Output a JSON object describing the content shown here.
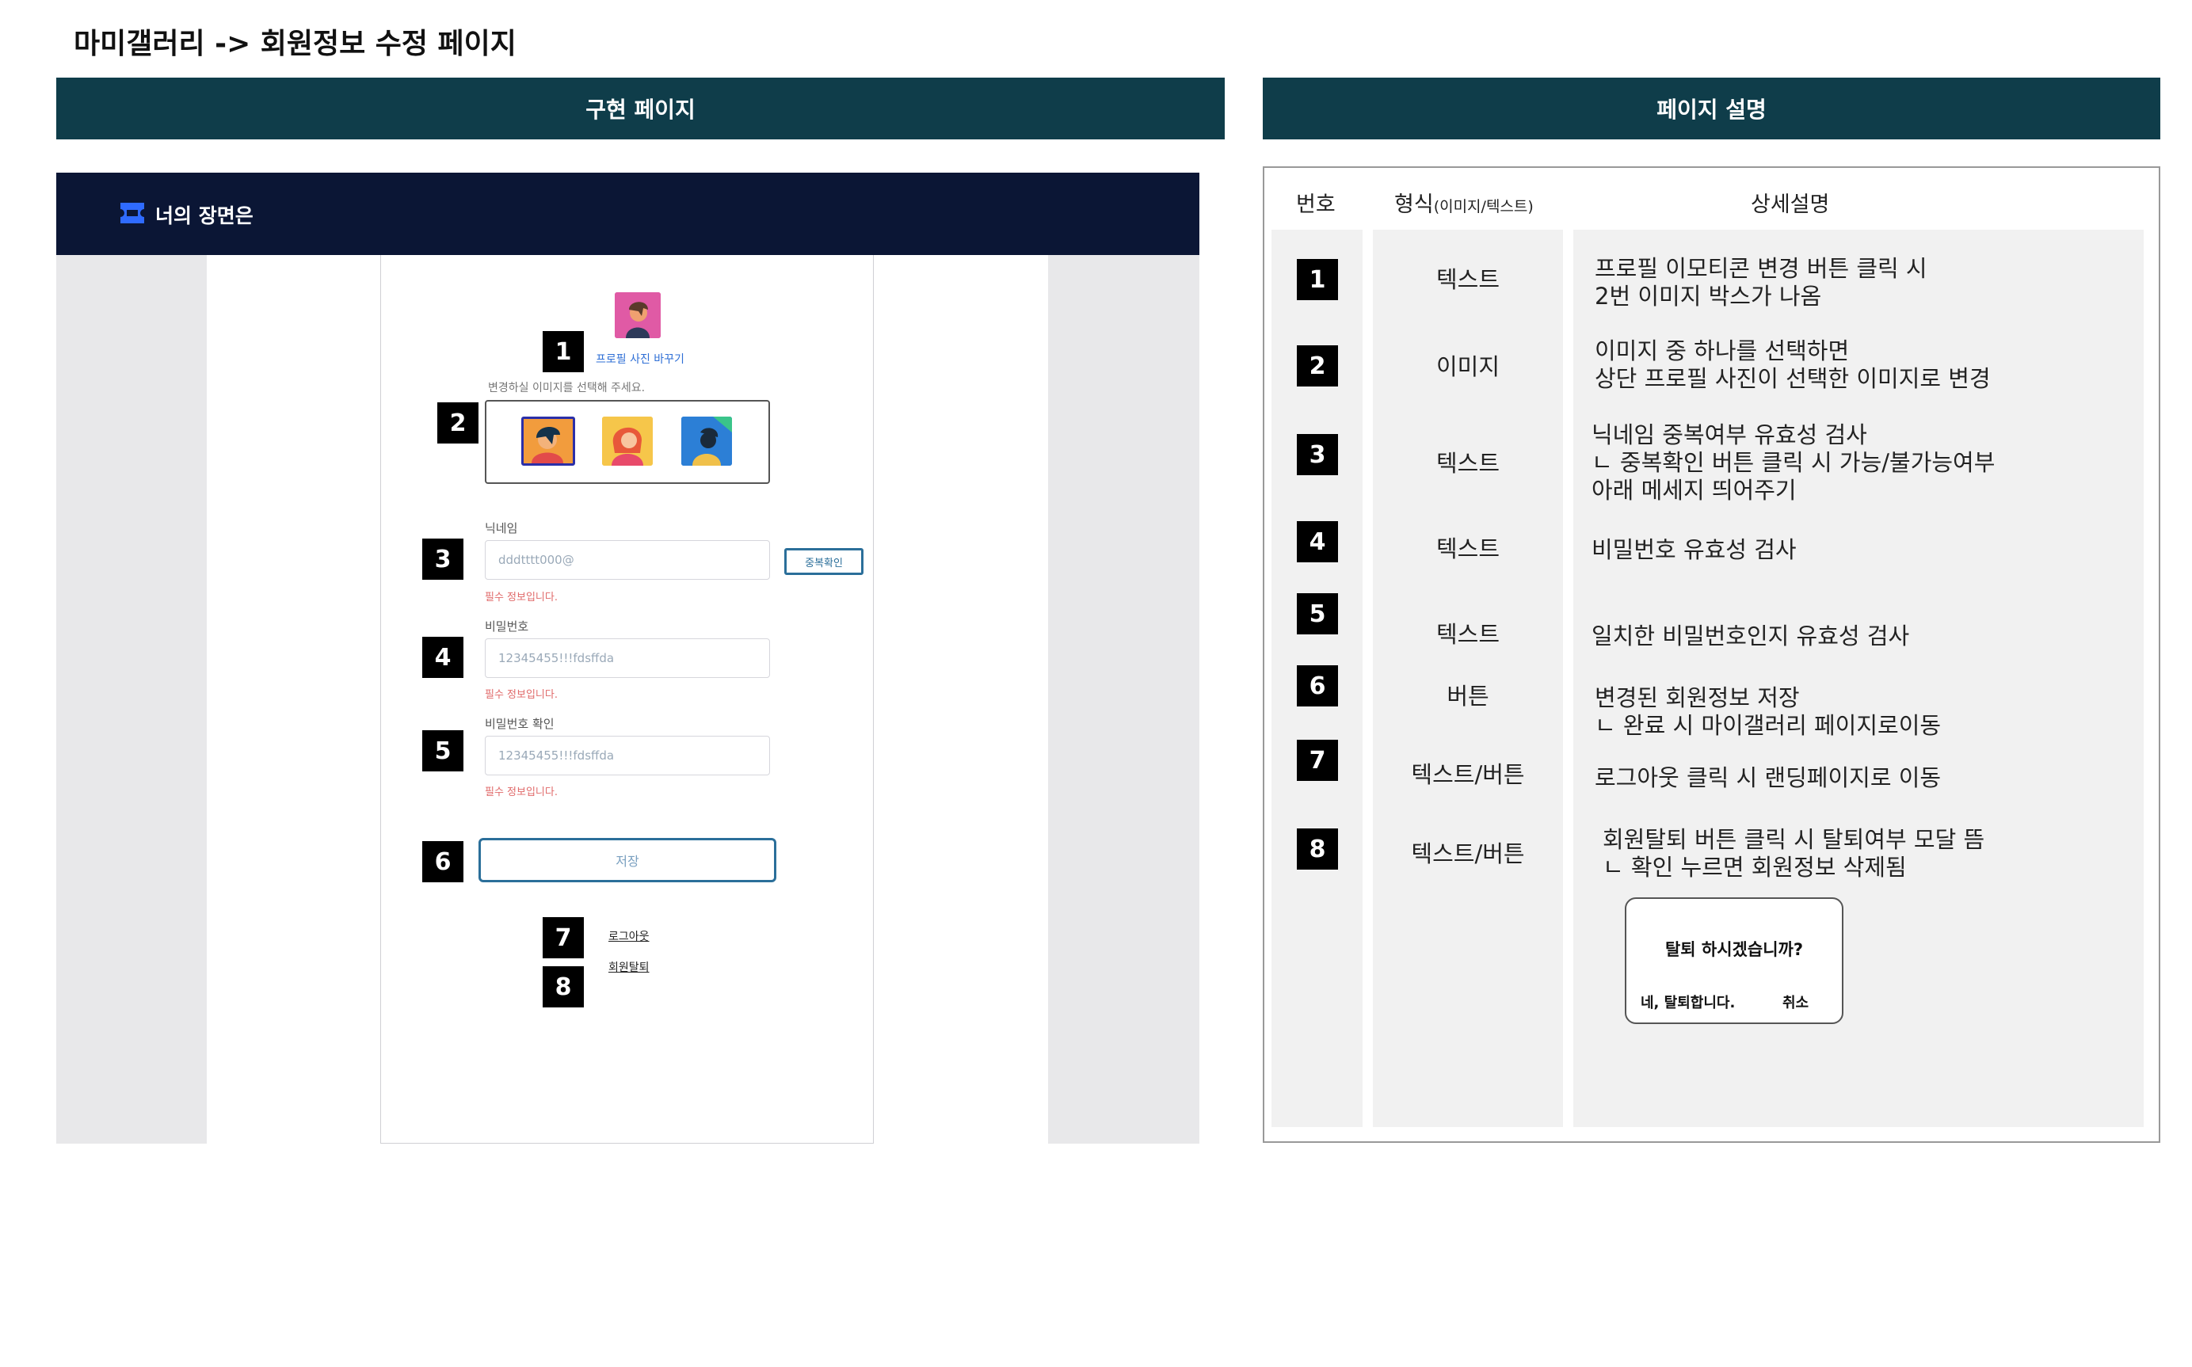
{
  "title": "마미갤러리 -> 회원정보 수정 페이지",
  "left_header": "구현 페이지",
  "right_header": "페이지 설명",
  "mockup": {
    "brand": "너의 장면은",
    "change_photo": "프로필 사진 바꾸기",
    "select_hint": "변경하실 이미지를 선택해 주세요.",
    "nickname_label": "닉네임",
    "nickname_value": "dddtttt000@",
    "duplicate_check": "중복확인",
    "password_label": "비밀번호",
    "password_value": "12345455!!!fdsffda",
    "password_confirm_label": "비밀번호 확인",
    "password_confirm_value": "12345455!!!fdsffda",
    "required_msg": "필수 정보입니다.",
    "save": "저장",
    "logout": "로그아웃",
    "withdraw": "회원탈퇴"
  },
  "markers": [
    "1",
    "2",
    "3",
    "4",
    "5",
    "6",
    "7",
    "8"
  ],
  "table": {
    "headers": {
      "no": "번호",
      "format": "형식",
      "format_sub": "(이미지/텍스트)",
      "detail": "상세설명"
    },
    "rows": [
      {
        "no": "1",
        "format": "텍스트",
        "detail": "프로필 이모티콘 변경 버튼 클릭 시\n2번 이미지 박스가 나옴"
      },
      {
        "no": "2",
        "format": "이미지",
        "detail": "이미지 중 하나를 선택하면\n상단 프로필 사진이 선택한 이미지로 변경"
      },
      {
        "no": "3",
        "format": "텍스트",
        "detail": "닉네임 중복여부 유효성 검사\nㄴ 중복확인 버튼 클릭 시 가능/불가능여부\n아래 메세지 띄어주기"
      },
      {
        "no": "4",
        "format": "텍스트",
        "detail": "비밀번호 유효성 검사"
      },
      {
        "no": "5",
        "format": "텍스트",
        "detail": "일치한 비밀번호인지 유효성 검사"
      },
      {
        "no": "6",
        "format": "버튼",
        "detail": "변경된 회원정보 저장\nㄴ 완료 시 마이갤러리 페이지로이동"
      },
      {
        "no": "7",
        "format": "텍스트/버튼",
        "detail": "로그아웃 클릭 시 랜딩페이지로 이동"
      },
      {
        "no": "8",
        "format": "텍스트/버튼",
        "detail": "회원탈퇴 버튼 클릭 시 탈퇴여부 모달 뜸\nㄴ 확인 누르면 회원정보 삭제됨"
      }
    ]
  },
  "modal": {
    "question": "탈퇴 하시겠습니까?",
    "confirm": "네, 탈퇴합니다.",
    "cancel": "취소"
  },
  "colors": {
    "header_bg": "#0f3d4a",
    "nav_bg": "#0b1635",
    "accent": "#2b6f9a",
    "error": "#e06a6a"
  }
}
